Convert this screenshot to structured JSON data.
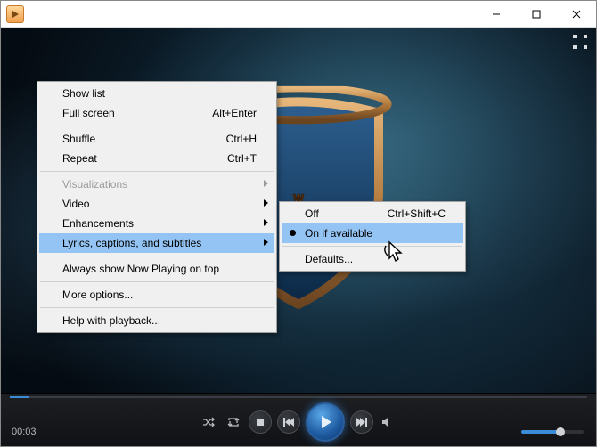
{
  "window": {
    "title": ""
  },
  "menu": {
    "show_list": "Show list",
    "full_screen": "Full screen",
    "full_screen_sc": "Alt+Enter",
    "shuffle": "Shuffle",
    "shuffle_sc": "Ctrl+H",
    "repeat": "Repeat",
    "repeat_sc": "Ctrl+T",
    "visualizations": "Visualizations",
    "video": "Video",
    "enhancements": "Enhancements",
    "lyrics": "Lyrics, captions, and subtitles",
    "always_top": "Always show Now Playing on top",
    "more_options": "More options...",
    "help": "Help with playback..."
  },
  "submenu": {
    "off": "Off",
    "off_sc": "Ctrl+Shift+C",
    "on_if_available": "On if available",
    "defaults": "Defaults..."
  },
  "playback": {
    "time": "00:03",
    "volume_percent": 58
  }
}
